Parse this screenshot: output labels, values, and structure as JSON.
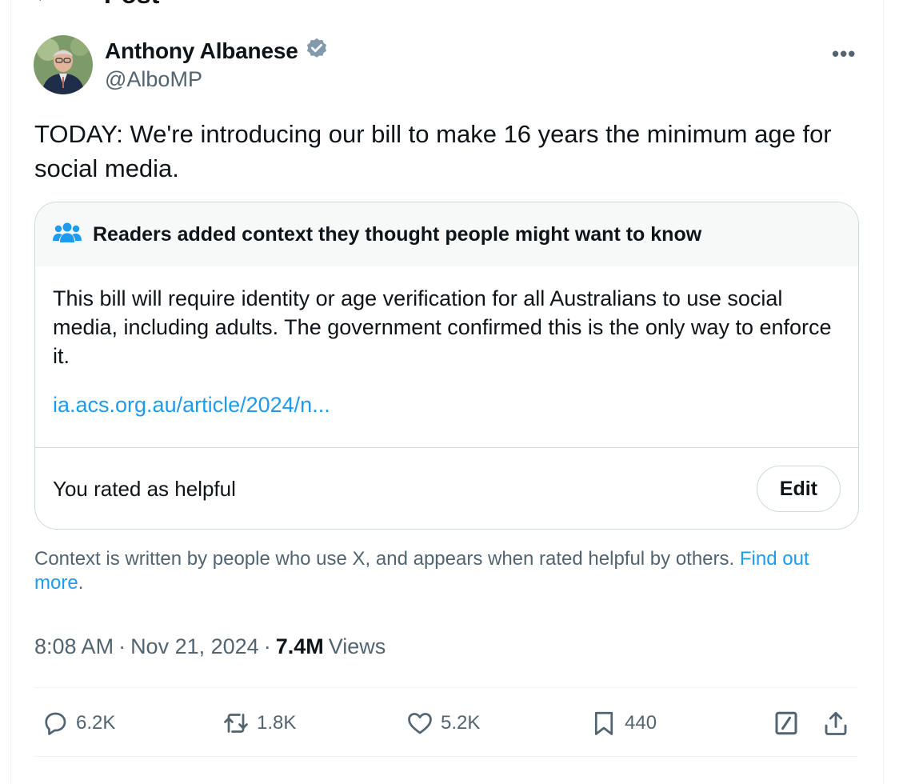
{
  "header": {
    "title": "Post"
  },
  "author": {
    "name": "Anthony Albanese",
    "handle": "@AlboMP"
  },
  "tweet": {
    "text": "TODAY: We're introducing our bill to make 16 years the minimum age for social media."
  },
  "community_note": {
    "heading": "Readers added context they thought people might want to know",
    "body": "This bill will require identity or age verification for all Australians to use social media, including adults. The government confirmed this is the only way to enforce it.",
    "link": "ia.acs.org.au/article/2024/n...",
    "rating_status": "You rated as helpful",
    "edit_label": "Edit"
  },
  "context_footer": {
    "text": "Context is written by people who use X, and appears when rated helpful by others.",
    "link": "Find out more",
    "suffix": "."
  },
  "meta": {
    "time": "8:08 AM",
    "separator": "·",
    "date": "Nov 21, 2024",
    "views_count": "7.4M",
    "views_label": "Views"
  },
  "actions": {
    "replies": "6.2K",
    "reposts": "1.8K",
    "likes": "5.2K",
    "bookmarks": "440"
  },
  "colors": {
    "accent": "#1d9bf0",
    "muted": "#536471",
    "text": "#0f1419",
    "border": "#cfd9de"
  }
}
